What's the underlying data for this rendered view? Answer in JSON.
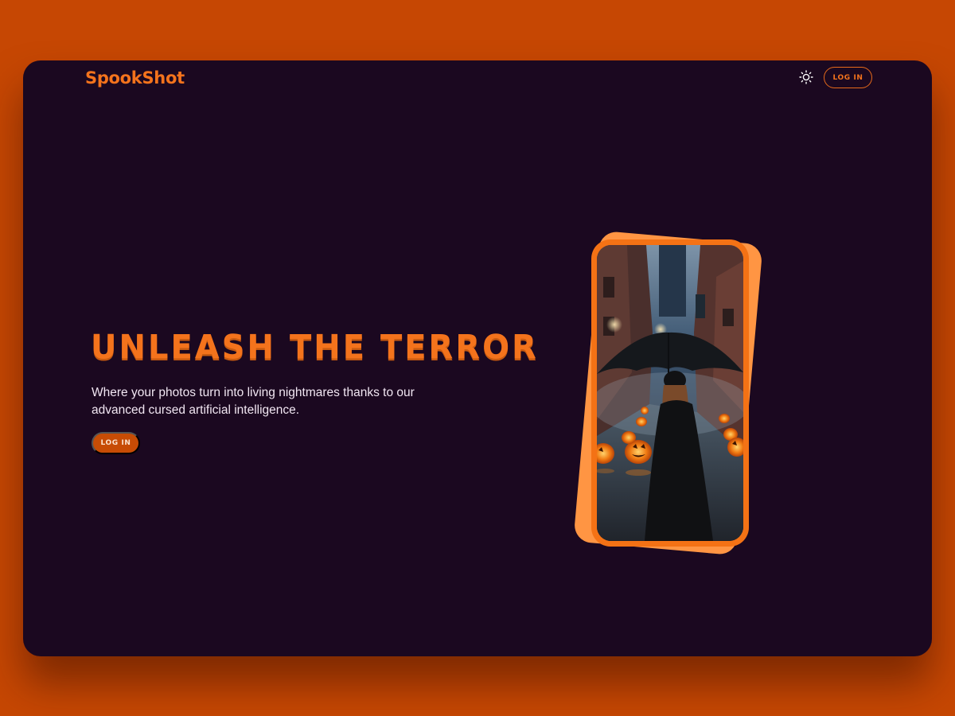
{
  "brand": {
    "name": "SpookShot"
  },
  "header": {
    "theme_toggle_icon": "sun-icon",
    "login_label": "LOG IN"
  },
  "hero": {
    "title": "UNLEASH THE TERROR",
    "subtitle": "Where your photos turn into living nightmares thanks to our advanced cursed artificial intelligence.",
    "cta_label": "LOG IN"
  },
  "showcase": {
    "image_icon": "woman-with-umbrella-in-pumpkin-alley-image"
  },
  "colors": {
    "page_background": "#c64703",
    "window_background": "#1b0820",
    "accent_orange": "#f4731c",
    "cta_background": "#c74c05",
    "phone_frame": "#f47215",
    "phone_back_card": "#ff9543",
    "text_light": "#f1e6f2"
  }
}
